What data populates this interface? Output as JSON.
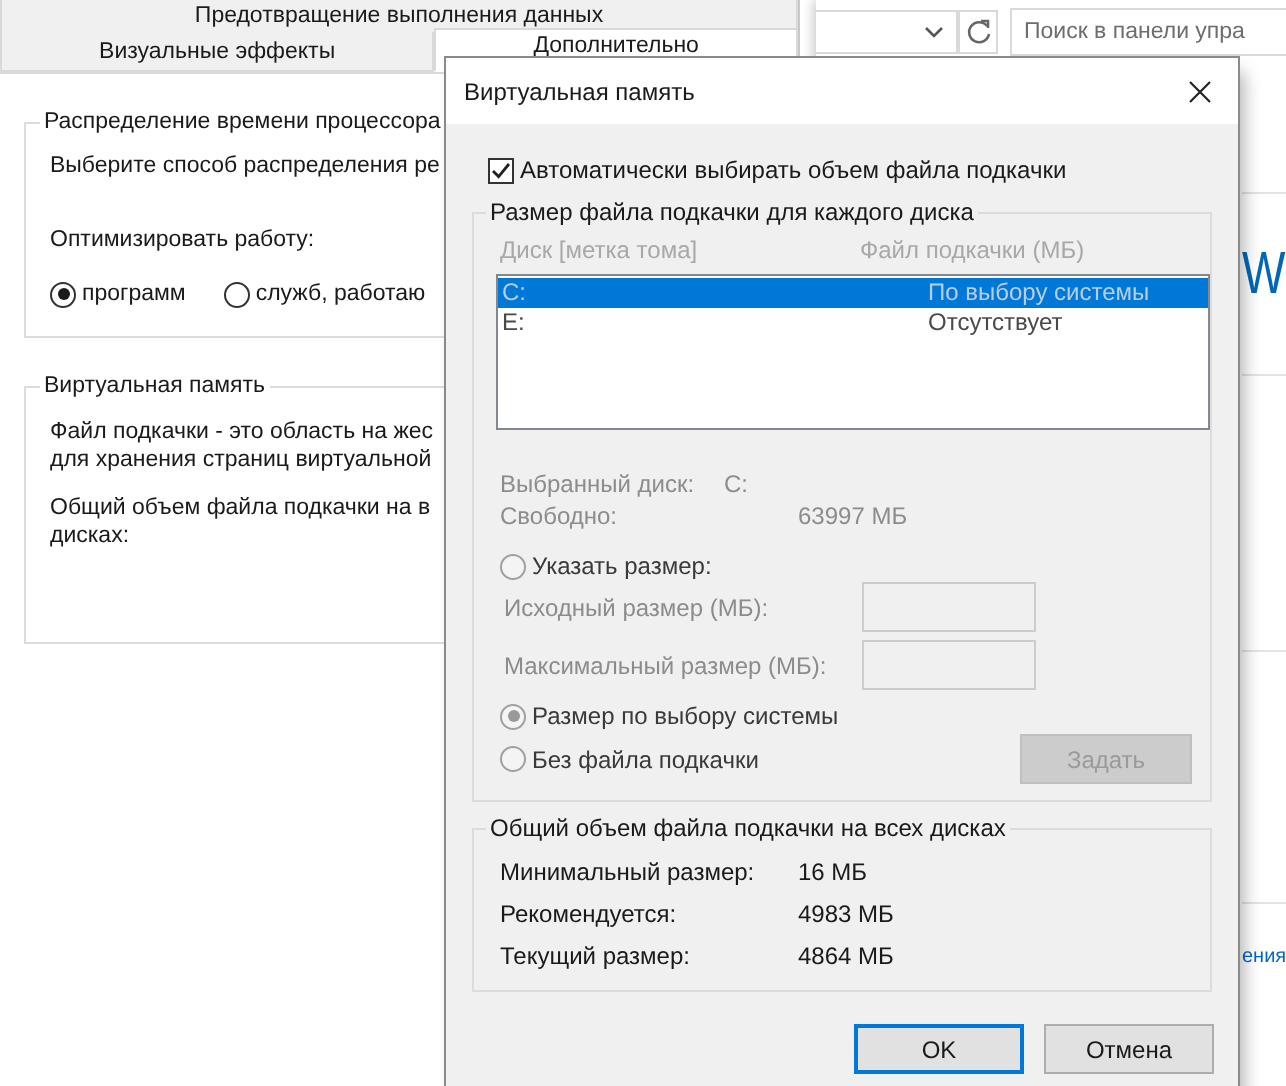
{
  "performance_window": {
    "tab_rows": [
      {
        "tabs": [
          {
            "label": "Предотвращение выполнения данных",
            "selected": false
          }
        ]
      },
      {
        "tabs": [
          {
            "label": "Визуальные эффекты",
            "selected": false
          },
          {
            "label": "Дополнительно",
            "selected": true
          }
        ]
      }
    ],
    "processor_group": {
      "title": "Распределение времени процессора",
      "description": "Выберите способ распределения ре",
      "optimize_label": "Оптимизировать работу:",
      "options": [
        {
          "label": "программ",
          "selected": true
        },
        {
          "label": "служб, работаю",
          "selected": false
        }
      ]
    },
    "virtual_memory_group": {
      "title": "Виртуальная память",
      "paragraphs": [
        [
          "Файл подкачки - это область на жес",
          "для хранения страниц виртуальной"
        ],
        [
          "Общий объем файла подкачки на в",
          "дисках:"
        ]
      ]
    }
  },
  "control_panel_window": {
    "search": {
      "placeholder": "Поиск в панели упра"
    },
    "heading": "W",
    "link": "ения"
  },
  "dialog": {
    "title": "Виртуальная память",
    "auto_manage": {
      "label": "Автоматически выбирать объем файла подкачки",
      "checked": true
    },
    "per_drive": {
      "title": "Размер файла подкачки для каждого диска",
      "disabled": true,
      "columns": [
        "Диск [метка тома]",
        "Файл подкачки (МБ)"
      ],
      "drives": [
        {
          "drive": "C:",
          "paging_file": "По выбору системы",
          "selected": true
        },
        {
          "drive": "E:",
          "paging_file": "Отсутствует",
          "selected": false
        }
      ],
      "info": [
        {
          "label": "Выбранный диск:",
          "value": "C:"
        },
        {
          "label": "Свободно:",
          "value": "63997 МБ"
        }
      ],
      "size_options": [
        {
          "label": "Указать размер:",
          "selected": false,
          "fields": [
            {
              "label": "Исходный размер (МБ):"
            },
            {
              "label": "Максимальный размер (МБ):"
            }
          ]
        },
        {
          "label": "Размер по выбору системы",
          "selected": true
        },
        {
          "label": "Без файла подкачки",
          "selected": false
        }
      ],
      "set_button": {
        "label": "Задать",
        "disabled": true
      }
    },
    "totals": {
      "title": "Общий объем файла подкачки на всех дисках",
      "rows": [
        {
          "label": "Минимальный размер:",
          "value": "16 МБ"
        },
        {
          "label": "Рекомендуется:",
          "value": "4983 МБ"
        },
        {
          "label": "Текущий размер:",
          "value": "4864 МБ"
        }
      ]
    },
    "buttons": [
      {
        "label": "OK",
        "default": true
      },
      {
        "label": "Отмена",
        "default": false
      }
    ]
  }
}
